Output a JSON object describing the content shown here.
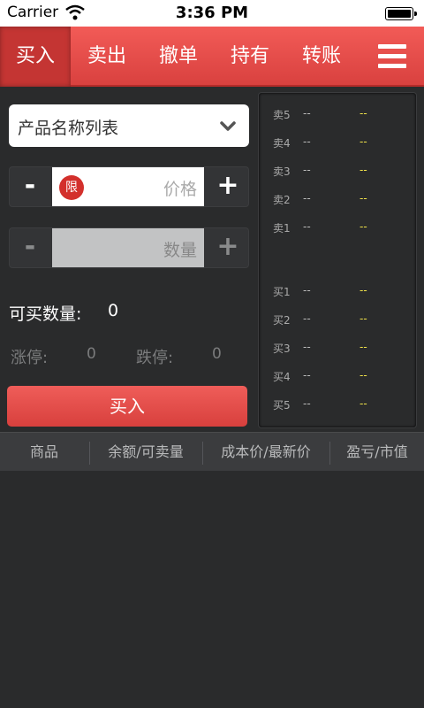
{
  "status_bar": {
    "carrier": "Carrier",
    "time": "3:36 PM"
  },
  "tabs": [
    {
      "label": "买入",
      "active": true
    },
    {
      "label": "卖出",
      "active": false
    },
    {
      "label": "撤单",
      "active": false
    },
    {
      "label": "持有",
      "active": false
    },
    {
      "label": "转账",
      "active": false
    }
  ],
  "form": {
    "product_select": "产品名称列表",
    "price": {
      "minus": "-",
      "plus": "+",
      "badge": "限",
      "placeholder": "价格"
    },
    "quantity": {
      "minus": "-",
      "plus": "+",
      "placeholder": "数量"
    },
    "buyable_label": "可买数量:",
    "buyable_value": "0",
    "limit_up_label": "涨停:",
    "limit_up_value": "0",
    "limit_down_label": "跌停:",
    "limit_down_value": "0",
    "buy_button": "买入"
  },
  "order_book": {
    "sells": [
      {
        "label": "卖5",
        "price": "--",
        "qty": "--"
      },
      {
        "label": "卖4",
        "price": "--",
        "qty": "--"
      },
      {
        "label": "卖3",
        "price": "--",
        "qty": "--"
      },
      {
        "label": "卖2",
        "price": "--",
        "qty": "--"
      },
      {
        "label": "卖1",
        "price": "--",
        "qty": "--"
      }
    ],
    "buys": [
      {
        "label": "买1",
        "price": "--",
        "qty": "--"
      },
      {
        "label": "买2",
        "price": "--",
        "qty": "--"
      },
      {
        "label": "买3",
        "price": "--",
        "qty": "--"
      },
      {
        "label": "买4",
        "price": "--",
        "qty": "--"
      },
      {
        "label": "买5",
        "price": "--",
        "qty": "--"
      }
    ]
  },
  "positions": {
    "columns": [
      "商品",
      "余额/可卖量",
      "成本价/最新价",
      "盈亏/市值"
    ]
  },
  "colors": {
    "accent": "#e04b48",
    "background": "#2a2b2c",
    "quantity": "#f0e24a"
  }
}
